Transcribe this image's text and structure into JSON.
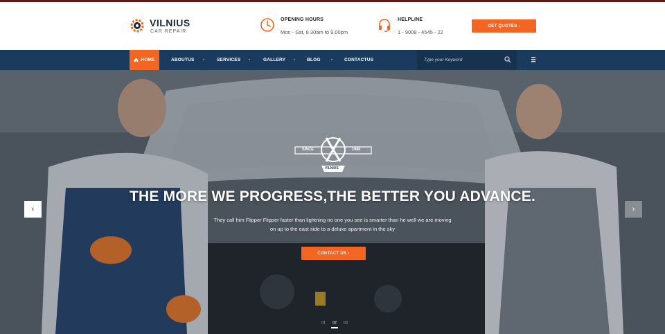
{
  "brand": {
    "name": "VILNIUS",
    "tagline": "CAR REPAIR"
  },
  "header": {
    "hours": {
      "title": "OPENING HOURS",
      "value": "Mon - Sat, 8.30am to 9.00pm",
      "icon": "clock-icon"
    },
    "helpline": {
      "title": "HELPLINE",
      "value": "1 - 9008 - 4545 - 22",
      "icon": "headset-icon"
    },
    "cta_label": "GET QUOTES ›"
  },
  "nav": {
    "items": [
      {
        "label": "HOME",
        "icon": "home-icon",
        "active": true
      },
      {
        "label": "ABOUTUS"
      },
      {
        "label": "SERVICES"
      },
      {
        "label": "GALLERY"
      },
      {
        "label": "BLOG"
      },
      {
        "label": "CONTACTUS"
      }
    ],
    "search_placeholder": "Type your Keyword"
  },
  "hero": {
    "emblem": {
      "since": "SINCE",
      "year": "1988",
      "name": "VILNIUS"
    },
    "heading": "THE MORE WE PROGRESS,THE BETTER YOU ADVANCE.",
    "text_line1": "They call him Flipper Flipper faster than lightning no one you see is smarter than he well we are moving",
    "text_line2": "on up to the east side to a deluxe apartment in the sky",
    "button_label": "CONTACT US ›",
    "prev_icon": "‹",
    "next_icon": "›",
    "pager": [
      "01",
      "02",
      "03"
    ],
    "pager_active": 1
  },
  "colors": {
    "accent": "#f26522",
    "nav_bg": "#1a3a5e",
    "brand_dark": "#1e2a3a"
  }
}
